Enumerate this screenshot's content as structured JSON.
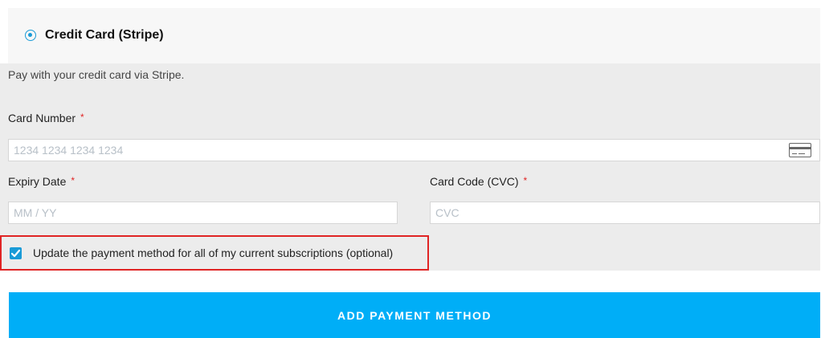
{
  "payment_method": {
    "title": "Credit Card (Stripe)",
    "description": "Pay with your credit card via Stripe."
  },
  "fields": {
    "card_number": {
      "label": "Card Number",
      "required_mark": "*",
      "placeholder": "1234 1234 1234 1234",
      "value": ""
    },
    "expiry": {
      "label": "Expiry Date",
      "required_mark": "*",
      "placeholder": "MM / YY",
      "value": ""
    },
    "cvc": {
      "label": "Card Code (CVC)",
      "required_mark": "*",
      "placeholder": "CVC",
      "value": ""
    }
  },
  "update_subscriptions": {
    "label": "Update the payment method for all of my current subscriptions (optional)",
    "checked": true
  },
  "submit": {
    "label": "ADD PAYMENT METHOD"
  },
  "colors": {
    "accent": "#00aef7",
    "radio": "#1a9bd7",
    "required": "#e02424",
    "highlight": "#e02424"
  },
  "icons": {
    "card": "credit-card-icon",
    "check": "checkmark-icon"
  }
}
